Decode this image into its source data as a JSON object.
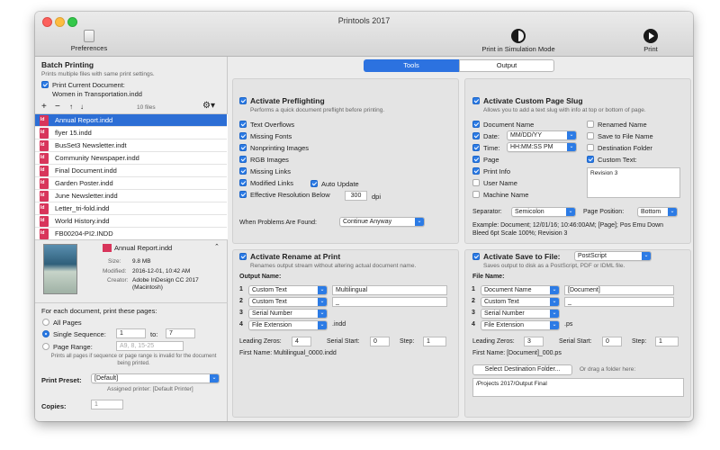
{
  "window": {
    "title": "Printools 2017"
  },
  "toolbar": {
    "preferences": "Preferences",
    "simulation": "Print in Simulation Mode",
    "print": "Print"
  },
  "sidebar": {
    "title": "Batch Printing",
    "subtitle": "Prints multiple files with same print settings.",
    "print_current_label": "Print Current Document:",
    "current_doc": "Women in Transportation.indd",
    "files_count": "10 files",
    "files": [
      "Annual Report.indd",
      "flyer 15.indd",
      "BusSet3 Newsletter.indt",
      "Community Newspaper.indd",
      "Final Document.indd",
      "Garden Poster.indd",
      "June Newsletter.indd",
      "Letter_tri-fold.indd",
      "World History.indd",
      "FB00204-PI2.INDD"
    ],
    "preview": {
      "file": "Annual Report.indd",
      "size_label": "Size:",
      "size": "9.8 MB",
      "modified_label": "Modified:",
      "modified": "2016-12-01, 10:42 AM",
      "creator_label": "Creator:",
      "creator": "Adobe InDesign CC 2017 (Macintosh)"
    },
    "each_doc": "For each document, print these pages:",
    "all_pages": "All Pages",
    "single_seq": "Single Sequence:",
    "seq_from": "1",
    "seq_to_label": "to:",
    "seq_to": "7",
    "page_range": "Page Range:",
    "page_range_placeholder": "A9, 8, 15-25",
    "range_note": "Prints all pages if sequence or page range is invalid for the document being printed.",
    "preset_label": "Print Preset:",
    "preset": "[Default]",
    "assigned": "Assigned printer: [Default Printer]",
    "copies_label": "Copies:",
    "copies": "1"
  },
  "tabs": [
    "Tools",
    "Output"
  ],
  "preflight": {
    "title": "Activate Preflighting",
    "desc": "Performs a quick document preflight before printing.",
    "items": [
      "Text Overflows",
      "Missing Fonts",
      "Nonprinting Images",
      "RGB Images",
      "Missing Links",
      "Modified Links",
      "Effective Resolution Below"
    ],
    "auto_update": "Auto Update",
    "resolution": "300",
    "dpi": "dpi",
    "problems_label": "When Problems Are Found:",
    "problems": "Continue Anyway"
  },
  "slug": {
    "title": "Activate Custom Page Slug",
    "desc": "Allows you to add a text slug with info at top or bottom of page.",
    "left": [
      "Document Name",
      "Date:",
      "Time:",
      "Page",
      "Print Info",
      "User Name",
      "Machine Name"
    ],
    "date_fmt": "MM/DD/YY",
    "time_fmt": "HH:MM:SS PM",
    "right": [
      "Renamed Name",
      "Save to File Name",
      "Destination Folder",
      "Custom Text:"
    ],
    "custom_text": "Revision 3",
    "sep_label": "Separator:",
    "sep": "Semicolon",
    "pos_label": "Page Position:",
    "pos": "Bottom",
    "example": "Example: Document; 12/01/16; 10:46:00AM; [Page]; Pos Emu Down Bleed 6pt Scale 100%; Revision 3"
  },
  "rename": {
    "title": "Activate Rename at Print",
    "desc": "Renames output stream without altering actual document name.",
    "output_label": "Output Name:",
    "rows": [
      {
        "n": "1",
        "type": "Custom Text",
        "val": "Multilingual"
      },
      {
        "n": "2",
        "type": "Custom Text",
        "val": "_"
      },
      {
        "n": "3",
        "type": "Serial Number",
        "val": ""
      },
      {
        "n": "4",
        "type": "File Extension",
        "val": ".indd"
      }
    ],
    "zeros_label": "Leading Zeros:",
    "zeros": "4",
    "start_label": "Serial Start:",
    "start": "0",
    "step_label": "Step:",
    "step": "1",
    "first_name": "First Name: Multilingual_0000.indd"
  },
  "savefile": {
    "title": "Activate Save to File:",
    "format": "PostScript",
    "desc": "Saves output to disk as a PostScript, PDF or IDML file.",
    "file_label": "File Name:",
    "rows": [
      {
        "n": "1",
        "type": "Document Name",
        "val": "[Document]"
      },
      {
        "n": "2",
        "type": "Custom Text",
        "val": "_"
      },
      {
        "n": "3",
        "type": "Serial Number",
        "val": ""
      },
      {
        "n": "4",
        "type": "File Extension",
        "val": ".ps"
      }
    ],
    "zeros_label": "Leading Zeros:",
    "zeros": "3",
    "start_label": "Serial Start:",
    "start": "0",
    "step_label": "Step:",
    "step": "1",
    "first_name": "First Name: [Document]_000.ps",
    "dest_btn": "Select Destination Folder...",
    "drag": "Or drag a folder here:",
    "path": "/Projects 2017/Output Final"
  }
}
